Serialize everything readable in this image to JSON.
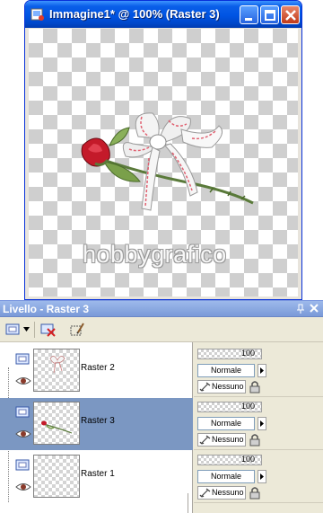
{
  "window": {
    "title": "Immagine1* @ 100% (Raster 3)",
    "watermark": "hobbygrafico",
    "buttons": [
      "minimize",
      "maximize",
      "close"
    ],
    "canvas_content": "rose-with-ribbon"
  },
  "palette": {
    "title": "Livello - Raster 3",
    "toolbar": [
      "new-raster-layer-icon",
      "dropdown-arrow-icon",
      "delete-layer-icon",
      "edit-selection-icon"
    ],
    "layers": [
      {
        "name": "Raster 2",
        "selected": false,
        "thumbnail": "ribbon",
        "opacity": "100",
        "blend": "Normale",
        "link": "Nessuno"
      },
      {
        "name": "Raster 3",
        "selected": true,
        "thumbnail": "rose",
        "opacity": "100",
        "blend": "Normale",
        "link": "Nessuno"
      },
      {
        "name": "Raster 1",
        "selected": false,
        "thumbnail": "empty",
        "opacity": "100",
        "blend": "Normale",
        "link": "Nessuno"
      }
    ]
  },
  "colors": {
    "titlebar": "#0054e3",
    "palette_title": "#7a9ad8",
    "selected_row": "#7b97c2",
    "rose": "#c41a2a",
    "ribbon_stripe": "#e06070"
  }
}
